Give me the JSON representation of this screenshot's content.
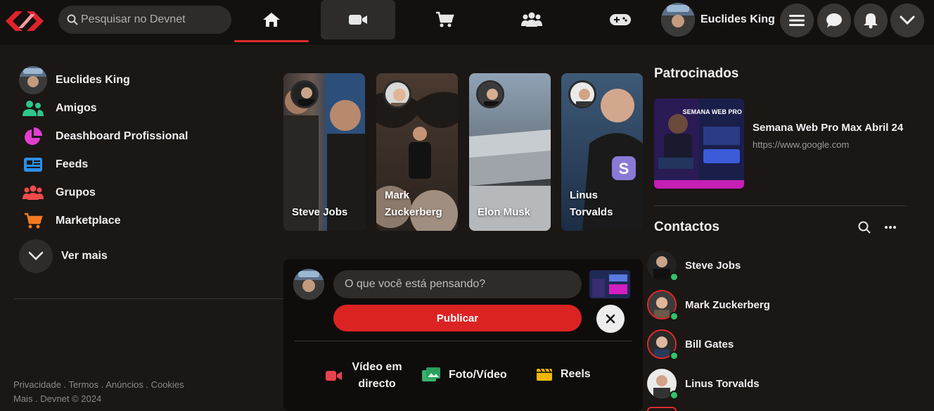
{
  "topbar": {
    "search_placeholder": "Pesquisar no Devnet",
    "nav": [
      "home-icon",
      "video-icon",
      "cart-icon",
      "friends-icon",
      "gamepad-icon"
    ],
    "profile_name": "Euclides King",
    "accent": "#e02a2a"
  },
  "sidebar": {
    "items": [
      {
        "label": "Euclides King",
        "icon": "avatar"
      },
      {
        "label": "Amigos",
        "icon": "friends-icon"
      },
      {
        "label": "Deashboard Profissional",
        "icon": "pie-chart-icon"
      },
      {
        "label": "Feeds",
        "icon": "newspaper-icon"
      },
      {
        "label": "Grupos",
        "icon": "groups-icon"
      },
      {
        "label": "Marketplace",
        "icon": "cart-icon"
      }
    ],
    "more_label": "Ver mais",
    "footer_line1": "Privacidade . Termos . Anúncios . Cookies",
    "footer_line2": "Mais . Devnet © 2024"
  },
  "stories": [
    {
      "name": "Steve Jobs"
    },
    {
      "name": "Mark Zuckerberg"
    },
    {
      "name": "Elon Musk"
    },
    {
      "name": "Linus Torvalds"
    }
  ],
  "composer": {
    "placeholder": "O que você está pensando?",
    "publish_label": "Publicar",
    "actions": [
      {
        "label": "Vídeo em directo",
        "icon": "live-video-icon",
        "color": "#e8424f"
      },
      {
        "label": "Foto/Vídeo",
        "icon": "photo-icon",
        "color": "#37b26c"
      },
      {
        "label": "Reels",
        "icon": "reels-icon",
        "color": "#f2b705"
      }
    ]
  },
  "sponsored": {
    "title": "Patrocinados",
    "ad_title": "Semana Web Pro Max Abril 24",
    "ad_url": "https://www.google.com",
    "ad_image_text": "SEMANA WEB PRO MAX"
  },
  "contacts": {
    "title": "Contactos",
    "list": [
      {
        "name": "Steve Jobs"
      },
      {
        "name": "Mark Zuckerberg"
      },
      {
        "name": "Bill Gates"
      },
      {
        "name": "Linus Torvalds"
      }
    ]
  }
}
